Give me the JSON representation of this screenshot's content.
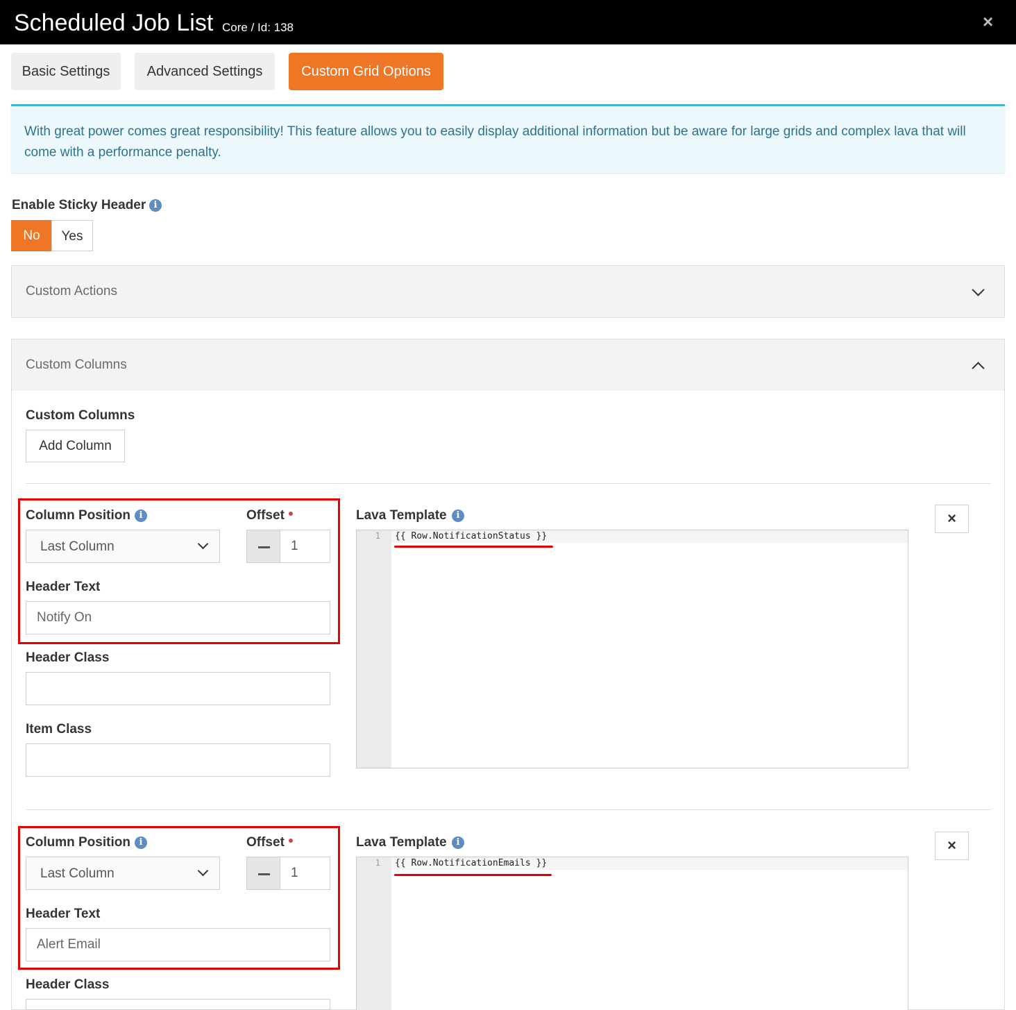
{
  "header": {
    "title": "Scheduled Job List",
    "subtitle": "Core / Id: 138",
    "close_icon": "×"
  },
  "tabs": [
    {
      "label": "Basic Settings",
      "active": false
    },
    {
      "label": "Advanced Settings",
      "active": false
    },
    {
      "label": "Custom Grid Options",
      "active": true
    }
  ],
  "alert": {
    "text": "With great power comes great responsibility! This feature allows you to easily display additional information but be aware for large grids and complex lava that will come with a performance penalty."
  },
  "sticky_header": {
    "label": "Enable Sticky Header",
    "options": [
      "No",
      "Yes"
    ],
    "selected": "No"
  },
  "custom_actions_panel": {
    "title": "Custom Actions",
    "expanded": false
  },
  "custom_columns_panel": {
    "title": "Custom Columns",
    "expanded": true,
    "section_label": "Custom Columns",
    "add_button": "Add Column"
  },
  "columns": [
    {
      "column_position_label": "Column Position",
      "column_position_value": "Last Column",
      "offset_label": "Offset",
      "offset_value": "1",
      "header_text_label": "Header Text",
      "header_text_value": "Notify On",
      "header_class_label": "Header Class",
      "header_class_value": "",
      "item_class_label": "Item Class",
      "item_class_value": "",
      "lava_template_label": "Lava Template",
      "lava_line_number": "1",
      "lava_code": "{{ Row.NotificationStatus }}"
    },
    {
      "column_position_label": "Column Position",
      "column_position_value": "Last Column",
      "offset_label": "Offset",
      "offset_value": "1",
      "header_text_label": "Header Text",
      "header_text_value": "Alert Email",
      "header_class_label": "Header Class",
      "lava_template_label": "Lava Template",
      "lava_line_number": "1",
      "lava_code": "{{ Row.NotificationEmails }}"
    }
  ],
  "colors": {
    "accent": "#ee7625",
    "title_bar": "#000000",
    "alert_bg": "#ecf8fc",
    "alert_border": "#3fb5d9",
    "highlight": "#e60000"
  }
}
